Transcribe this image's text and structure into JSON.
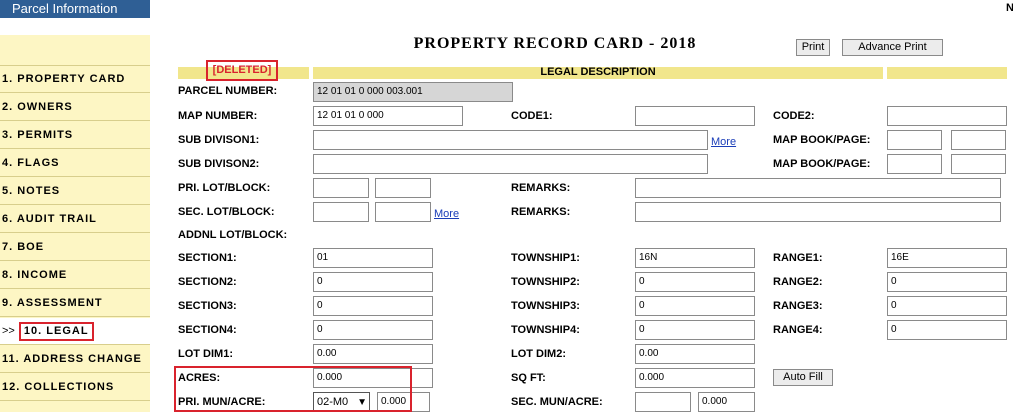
{
  "app": {
    "title": "Parcel Information",
    "top_right_letter": "N"
  },
  "sidebar": {
    "items": [
      {
        "label": "1. PROPERTY CARD"
      },
      {
        "label": "2. OWNERS"
      },
      {
        "label": "3. PERMITS"
      },
      {
        "label": "4. FLAGS"
      },
      {
        "label": "5. NOTES"
      },
      {
        "label": "6. AUDIT TRAIL"
      },
      {
        "label": "7. BOE"
      },
      {
        "label": "8. INCOME"
      },
      {
        "label": "9. ASSESSMENT"
      },
      {
        "label": "10. LEGAL",
        "prefix": ">>",
        "active": true
      },
      {
        "label": "11. ADDRESS CHANGE"
      },
      {
        "label": "12. COLLECTIONS"
      }
    ]
  },
  "header": {
    "title": "PROPERTY RECORD CARD - 2018",
    "print_label": "Print",
    "advance_print_label": "Advance Print"
  },
  "section": {
    "status": "[DELETED]",
    "title": "LEGAL DESCRIPTION"
  },
  "fields": {
    "parcel_number": {
      "label": "PARCEL NUMBER:",
      "value": "12 01 01 0 000 003.001"
    },
    "map_number": {
      "label": "MAP NUMBER:",
      "value": "12 01 01 0 000"
    },
    "code1": {
      "label": "CODE1:",
      "value": ""
    },
    "code2": {
      "label": "CODE2:",
      "value": ""
    },
    "sub_division1": {
      "label": "SUB DIVISON1:",
      "value": ""
    },
    "sub_division2": {
      "label": "SUB DIVISON2:",
      "value": ""
    },
    "more_label": "More",
    "map_book_page1": {
      "label": "MAP BOOK/PAGE:",
      "book": "",
      "page": ""
    },
    "map_book_page2": {
      "label": "MAP BOOK/PAGE:",
      "book": "",
      "page": ""
    },
    "pri_lot_block": {
      "label": "PRI. LOT/BLOCK:",
      "lot": "",
      "block": ""
    },
    "sec_lot_block": {
      "label": "SEC. LOT/BLOCK:",
      "lot": "",
      "block": ""
    },
    "remarks1": {
      "label": "REMARKS:",
      "value": ""
    },
    "remarks2": {
      "label": "REMARKS:",
      "value": ""
    },
    "addnl_lot_block": {
      "label": "ADDNL LOT/BLOCK:"
    },
    "section1": {
      "label": "SECTION1:",
      "value": "01"
    },
    "section2": {
      "label": "SECTION2:",
      "value": "0"
    },
    "section3": {
      "label": "SECTION3:",
      "value": "0"
    },
    "section4": {
      "label": "SECTION4:",
      "value": "0"
    },
    "township1": {
      "label": "TOWNSHIP1:",
      "value": "16N"
    },
    "township2": {
      "label": "TOWNSHIP2:",
      "value": "0"
    },
    "township3": {
      "label": "TOWNSHIP3:",
      "value": "0"
    },
    "township4": {
      "label": "TOWNSHIP4:",
      "value": "0"
    },
    "range1": {
      "label": "RANGE1:",
      "value": "16E"
    },
    "range2": {
      "label": "RANGE2:",
      "value": "0"
    },
    "range3": {
      "label": "RANGE3:",
      "value": "0"
    },
    "range4": {
      "label": "RANGE4:",
      "value": "0"
    },
    "lot_dim1": {
      "label": "LOT DIM1:",
      "value": "0.00"
    },
    "lot_dim2": {
      "label": "LOT DIM2:",
      "value": "0.00"
    },
    "acres": {
      "label": "ACRES:",
      "value": "0.000"
    },
    "sq_ft": {
      "label": "SQ FT:",
      "value": "0.000"
    },
    "auto_fill_label": "Auto Fill",
    "pri_mun_acre": {
      "label": "PRI. MUN/ACRE:",
      "select_value": "02-M0",
      "value": "0.000"
    },
    "sec_mun_acre": {
      "label": "SEC. MUN/ACRE:",
      "select_value": "",
      "value": "0.000"
    }
  },
  "colors": {
    "brand_blue": "#2f5f95",
    "sidebar_yellow": "#fdf6c4",
    "header_yellow": "#f1e68c",
    "highlight_red": "#d9232d"
  }
}
